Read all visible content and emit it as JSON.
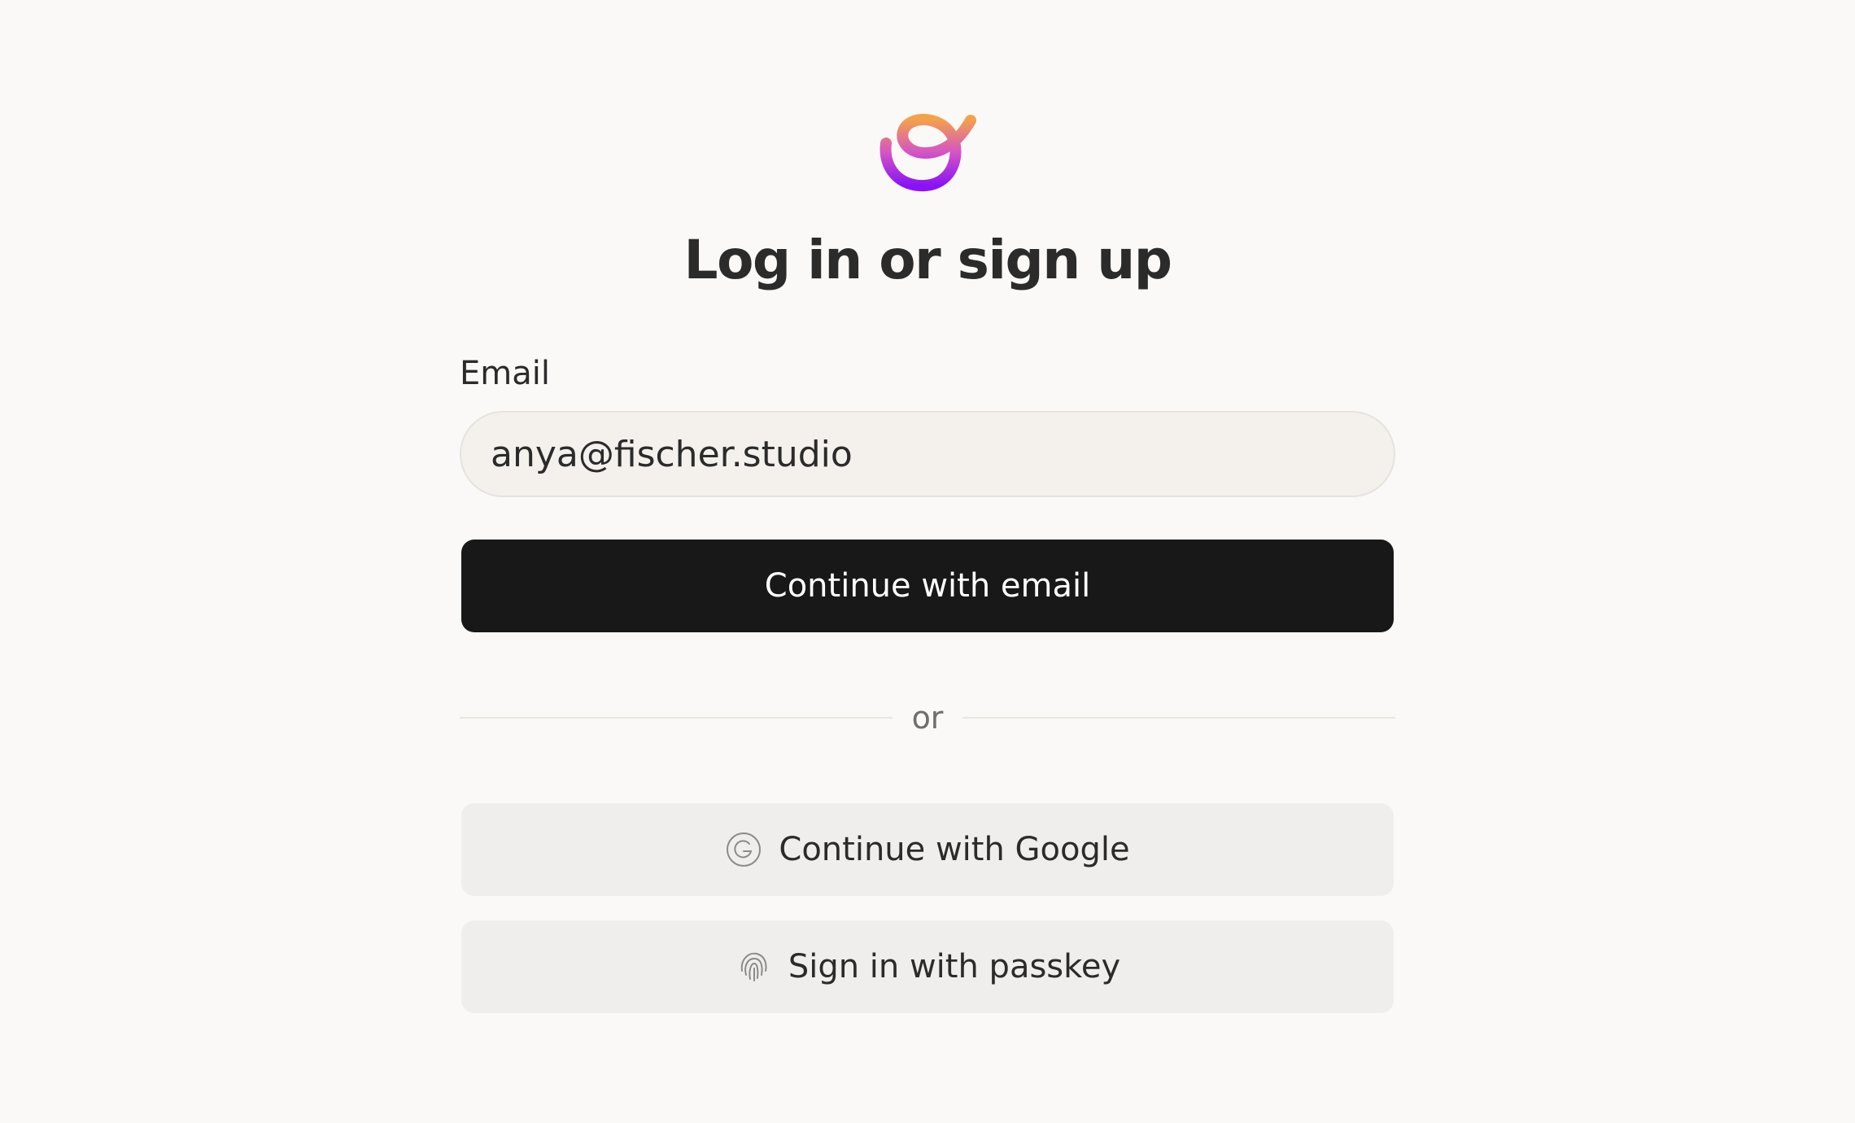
{
  "brand": {
    "logo_icon": "swirl-logo-icon",
    "logo_gradient": [
      "#f4a14a",
      "#d553c6",
      "#8a12f5"
    ]
  },
  "auth": {
    "title": "Log in or sign up",
    "email_label": "Email",
    "email_value": "anya@fischer.studio",
    "continue_email_label": "Continue with email",
    "divider_text": "or",
    "google_label": "Continue with Google",
    "google_icon": "google-g-icon",
    "passkey_label": "Sign in with passkey",
    "passkey_icon": "fingerprint-icon"
  },
  "colors": {
    "background": "#faf9f7",
    "primary_button": "#181818",
    "secondary_button": "#efeeec",
    "input_background": "#f4f1ed"
  }
}
